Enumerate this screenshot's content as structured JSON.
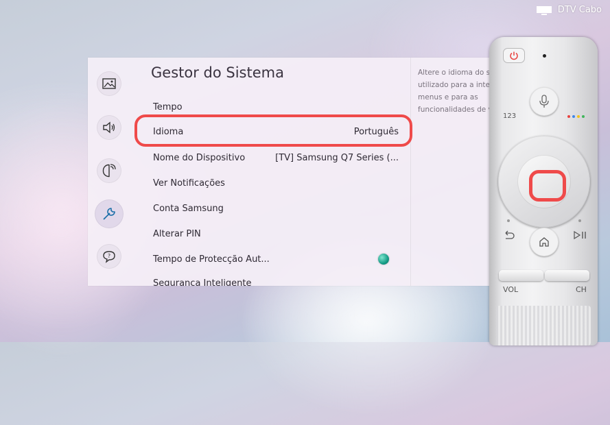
{
  "status": {
    "source_label": "DTV Cabo"
  },
  "panel": {
    "title": "Gestor do Sistema",
    "nav_icons": [
      "picture-icon",
      "sound-icon",
      "broadcast-icon",
      "support-tools-icon",
      "help-icon"
    ],
    "active_nav": "support-tools-icon",
    "items": [
      {
        "label": "Tempo",
        "value": ""
      },
      {
        "label": "Idioma",
        "value": "Português",
        "highlighted": true
      },
      {
        "label": "Nome do Dispositivo",
        "value": "[TV] Samsung Q7 Series (..."
      },
      {
        "label": "Ver Notificações",
        "value": ""
      },
      {
        "label": "Conta Samsung",
        "value": ""
      },
      {
        "label": "Alterar PIN",
        "value": ""
      },
      {
        "label": "Tempo de Protecção Aut...",
        "value": "",
        "toggle_on": true
      },
      {
        "label": "Segurança Inteligente",
        "value": ""
      }
    ],
    "description": "Altere o idioma do sis\nutilizado para a interf\nmenus e para as\nfuncionalidades de vo"
  },
  "remote": {
    "numbers_label": "123",
    "vol_label": "VOL",
    "ch_label": "CH",
    "highlight_color": "#ef4a4a",
    "color_dots": [
      "#e8423f",
      "#3f86e8",
      "#f2c21b",
      "#3fb55a"
    ]
  },
  "colors": {
    "highlight": "#ef4a4a",
    "toggle": "#159c86"
  }
}
